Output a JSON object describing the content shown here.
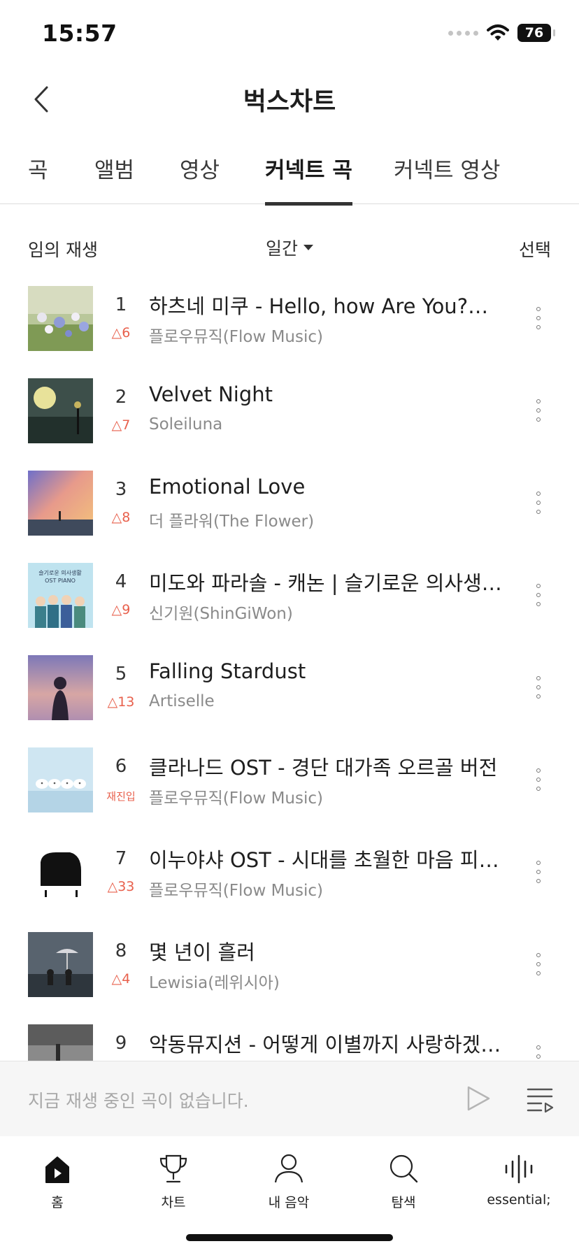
{
  "status_bar": {
    "time": "15:57",
    "battery": "76"
  },
  "header": {
    "title": "벅스차트"
  },
  "tabs": [
    {
      "label": "곡",
      "active": false
    },
    {
      "label": "앨범",
      "active": false
    },
    {
      "label": "영상",
      "active": false
    },
    {
      "label": "커넥트 곡",
      "active": true
    },
    {
      "label": "커넥트 영상",
      "active": false
    }
  ],
  "controls": {
    "shuffle_label": "임의 재생",
    "period_label": "일간",
    "select_label": "선택"
  },
  "chart": [
    {
      "rank": "1",
      "change": "△6",
      "title": "하츠네 미쿠 - Hello, how Are You?…",
      "artist": "플로우뮤직(Flow Music)"
    },
    {
      "rank": "2",
      "change": "△7",
      "title": "Velvet Night",
      "artist": "Soleiluna"
    },
    {
      "rank": "3",
      "change": "△8",
      "title": "Emotional Love",
      "artist": "더 플라워(The Flower)"
    },
    {
      "rank": "4",
      "change": "△9",
      "title": "미도와 파라솔 - 캐논 | 슬기로운 의사생…",
      "artist": "신기원(ShinGiWon)"
    },
    {
      "rank": "5",
      "change": "△13",
      "title": "Falling Stardust",
      "artist": "Artiselle"
    },
    {
      "rank": "6",
      "change": "재진입",
      "title": "클라나드 OST - 경단 대가족 오르골 버전",
      "artist": "플로우뮤직(Flow Music)"
    },
    {
      "rank": "7",
      "change": "△33",
      "title": "이누야샤 OST - 시대를 초월한 마음 피…",
      "artist": "플로우뮤직(Flow Music)"
    },
    {
      "rank": "8",
      "change": "△4",
      "title": "몇 년이 흘러",
      "artist": "Lewisia(레위시아)"
    },
    {
      "rank": "9",
      "change": "",
      "title": "악동뮤지션 - 어떻게 이별까지 사랑하겠…",
      "artist": ""
    }
  ],
  "album_art_text": {
    "row4_line1": "슬기로운 의사생활",
    "row4_line2": "OST PIANO"
  },
  "mini_player": {
    "empty_text": "지금 재생 중인 곡이 없습니다."
  },
  "bottom_nav": [
    {
      "label": "홈",
      "icon": "home-icon"
    },
    {
      "label": "차트",
      "icon": "trophy-icon"
    },
    {
      "label": "내 음악",
      "icon": "person-icon"
    },
    {
      "label": "탐색",
      "icon": "search-icon"
    },
    {
      "label": "essential;",
      "icon": "waveform-icon"
    }
  ],
  "colors": {
    "rank_change": "#e8604c",
    "tab_underline": "#333333",
    "player_bg": "#f6f6f6"
  }
}
